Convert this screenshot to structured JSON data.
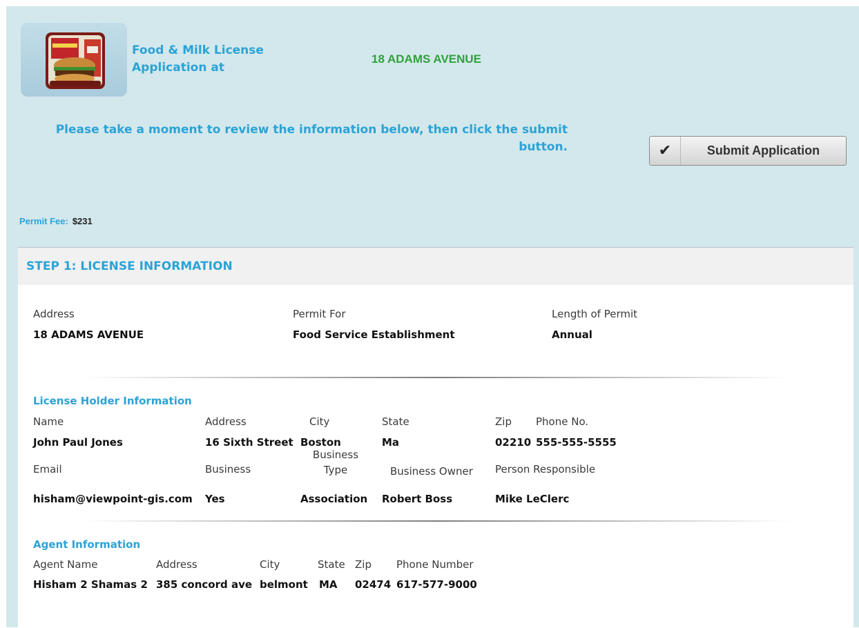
{
  "header": {
    "title": "Food & Milk License Application at",
    "address": "18 ADAMS AVENUE",
    "logo_icon": "burger-icon"
  },
  "review": {
    "message": "Please take a moment to review the information below, then click the submit button."
  },
  "submit": {
    "label": "Submit Application",
    "icon": "checkmark-icon"
  },
  "fee": {
    "label": "Permit Fee:",
    "value": "$231"
  },
  "step1": {
    "title": "STEP 1: LICENSE INFORMATION",
    "address_label": "Address",
    "address_value": "18 ADAMS AVENUE",
    "permit_for_label": "Permit For",
    "permit_for_value": "Food Service Establishment",
    "length_label": "Length of Permit",
    "length_value": "Annual"
  },
  "license_holder": {
    "section_title": "License Holder Information",
    "name_label": "Name",
    "name_value": "John Paul Jones",
    "address_label": "Address",
    "address_value": "16 Sixth Street",
    "city_label": "City",
    "city_value": "Boston",
    "state_label": "State",
    "state_value": "Ma",
    "zip_label": "Zip",
    "zip_value": "02210",
    "phone_label": "Phone No.",
    "phone_value": "555-555-5555",
    "email_label": "Email",
    "email_value": "hisham@viewpoint-gis.com",
    "business_label": "Business",
    "business_value": "Yes",
    "business_type_label": "Business Type",
    "business_type_value": "Association",
    "business_owner_label": "Business Owner",
    "business_owner_value": "Robert Boss",
    "person_responsible_label": "Person Responsible",
    "person_responsible_value": "Mike LeClerc"
  },
  "agent": {
    "section_title": "Agent Information",
    "name_label": "Agent Name",
    "name_value": "Hisham 2 Shamas 2",
    "address_label": "Address",
    "address_value": "385 concord ave",
    "city_label": "City",
    "city_value": "belmont",
    "state_label": "State",
    "state_value": "MA",
    "zip_label": "Zip",
    "zip_value": "02474",
    "phone_label": "Phone Number",
    "phone_value": "617-577-9000"
  },
  "colors": {
    "accent_blue": "#2ba3d6",
    "address_green": "#2ea23a",
    "page_background": "#d3e8ec"
  }
}
